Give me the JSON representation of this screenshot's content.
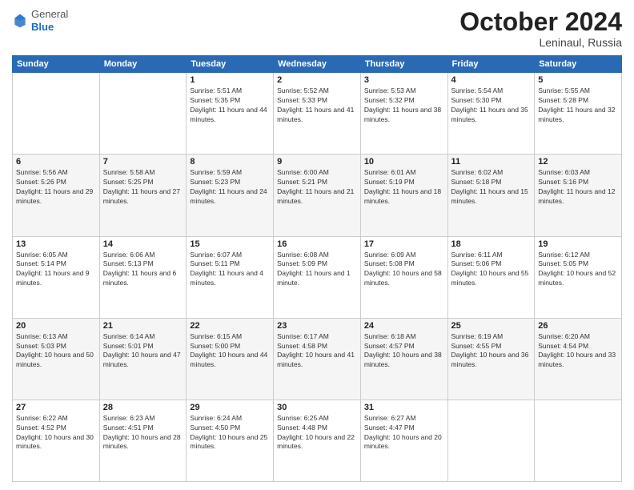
{
  "logo": {
    "general": "General",
    "blue": "Blue"
  },
  "header": {
    "month": "October 2024",
    "location": "Leninaul, Russia"
  },
  "weekdays": [
    "Sunday",
    "Monday",
    "Tuesday",
    "Wednesday",
    "Thursday",
    "Friday",
    "Saturday"
  ],
  "weeks": [
    [
      {
        "day": "",
        "info": ""
      },
      {
        "day": "",
        "info": ""
      },
      {
        "day": "1",
        "info": "Sunrise: 5:51 AM\nSunset: 5:35 PM\nDaylight: 11 hours and 44 minutes."
      },
      {
        "day": "2",
        "info": "Sunrise: 5:52 AM\nSunset: 5:33 PM\nDaylight: 11 hours and 41 minutes."
      },
      {
        "day": "3",
        "info": "Sunrise: 5:53 AM\nSunset: 5:32 PM\nDaylight: 11 hours and 38 minutes."
      },
      {
        "day": "4",
        "info": "Sunrise: 5:54 AM\nSunset: 5:30 PM\nDaylight: 11 hours and 35 minutes."
      },
      {
        "day": "5",
        "info": "Sunrise: 5:55 AM\nSunset: 5:28 PM\nDaylight: 11 hours and 32 minutes."
      }
    ],
    [
      {
        "day": "6",
        "info": "Sunrise: 5:56 AM\nSunset: 5:26 PM\nDaylight: 11 hours and 29 minutes."
      },
      {
        "day": "7",
        "info": "Sunrise: 5:58 AM\nSunset: 5:25 PM\nDaylight: 11 hours and 27 minutes."
      },
      {
        "day": "8",
        "info": "Sunrise: 5:59 AM\nSunset: 5:23 PM\nDaylight: 11 hours and 24 minutes."
      },
      {
        "day": "9",
        "info": "Sunrise: 6:00 AM\nSunset: 5:21 PM\nDaylight: 11 hours and 21 minutes."
      },
      {
        "day": "10",
        "info": "Sunrise: 6:01 AM\nSunset: 5:19 PM\nDaylight: 11 hours and 18 minutes."
      },
      {
        "day": "11",
        "info": "Sunrise: 6:02 AM\nSunset: 5:18 PM\nDaylight: 11 hours and 15 minutes."
      },
      {
        "day": "12",
        "info": "Sunrise: 6:03 AM\nSunset: 5:16 PM\nDaylight: 11 hours and 12 minutes."
      }
    ],
    [
      {
        "day": "13",
        "info": "Sunrise: 6:05 AM\nSunset: 5:14 PM\nDaylight: 11 hours and 9 minutes."
      },
      {
        "day": "14",
        "info": "Sunrise: 6:06 AM\nSunset: 5:13 PM\nDaylight: 11 hours and 6 minutes."
      },
      {
        "day": "15",
        "info": "Sunrise: 6:07 AM\nSunset: 5:11 PM\nDaylight: 11 hours and 4 minutes."
      },
      {
        "day": "16",
        "info": "Sunrise: 6:08 AM\nSunset: 5:09 PM\nDaylight: 11 hours and 1 minute."
      },
      {
        "day": "17",
        "info": "Sunrise: 6:09 AM\nSunset: 5:08 PM\nDaylight: 10 hours and 58 minutes."
      },
      {
        "day": "18",
        "info": "Sunrise: 6:11 AM\nSunset: 5:06 PM\nDaylight: 10 hours and 55 minutes."
      },
      {
        "day": "19",
        "info": "Sunrise: 6:12 AM\nSunset: 5:05 PM\nDaylight: 10 hours and 52 minutes."
      }
    ],
    [
      {
        "day": "20",
        "info": "Sunrise: 6:13 AM\nSunset: 5:03 PM\nDaylight: 10 hours and 50 minutes."
      },
      {
        "day": "21",
        "info": "Sunrise: 6:14 AM\nSunset: 5:01 PM\nDaylight: 10 hours and 47 minutes."
      },
      {
        "day": "22",
        "info": "Sunrise: 6:15 AM\nSunset: 5:00 PM\nDaylight: 10 hours and 44 minutes."
      },
      {
        "day": "23",
        "info": "Sunrise: 6:17 AM\nSunset: 4:58 PM\nDaylight: 10 hours and 41 minutes."
      },
      {
        "day": "24",
        "info": "Sunrise: 6:18 AM\nSunset: 4:57 PM\nDaylight: 10 hours and 38 minutes."
      },
      {
        "day": "25",
        "info": "Sunrise: 6:19 AM\nSunset: 4:55 PM\nDaylight: 10 hours and 36 minutes."
      },
      {
        "day": "26",
        "info": "Sunrise: 6:20 AM\nSunset: 4:54 PM\nDaylight: 10 hours and 33 minutes."
      }
    ],
    [
      {
        "day": "27",
        "info": "Sunrise: 6:22 AM\nSunset: 4:52 PM\nDaylight: 10 hours and 30 minutes."
      },
      {
        "day": "28",
        "info": "Sunrise: 6:23 AM\nSunset: 4:51 PM\nDaylight: 10 hours and 28 minutes."
      },
      {
        "day": "29",
        "info": "Sunrise: 6:24 AM\nSunset: 4:50 PM\nDaylight: 10 hours and 25 minutes."
      },
      {
        "day": "30",
        "info": "Sunrise: 6:25 AM\nSunset: 4:48 PM\nDaylight: 10 hours and 22 minutes."
      },
      {
        "day": "31",
        "info": "Sunrise: 6:27 AM\nSunset: 4:47 PM\nDaylight: 10 hours and 20 minutes."
      },
      {
        "day": "",
        "info": ""
      },
      {
        "day": "",
        "info": ""
      }
    ]
  ]
}
